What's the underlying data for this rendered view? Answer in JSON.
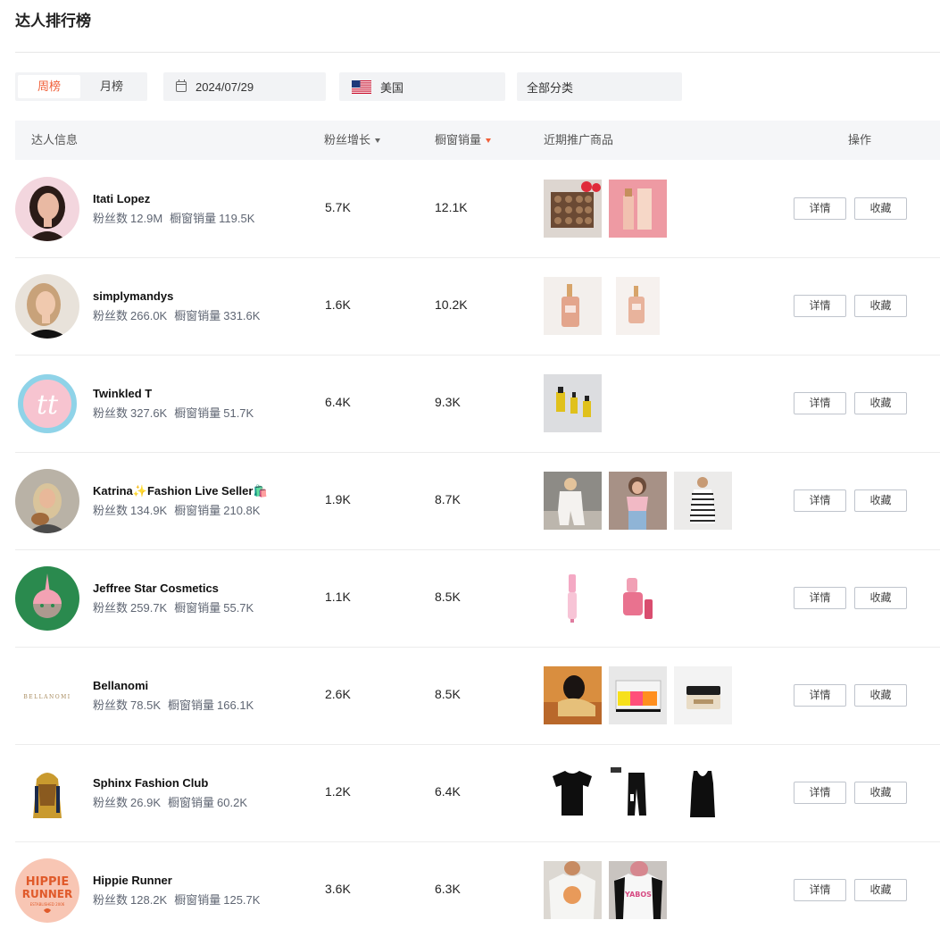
{
  "page": {
    "title": "达人排行榜"
  },
  "filters": {
    "tabs": [
      {
        "label": "周榜",
        "active": true
      },
      {
        "label": "月榜",
        "active": false
      }
    ],
    "date": "2024/07/29",
    "country": "美国",
    "category": "全部分类"
  },
  "table": {
    "headers": {
      "info": "达人信息",
      "fans_growth": "粉丝增长",
      "window_sales": "橱窗销量",
      "recent_products": "近期推广商品",
      "actions": "操作"
    },
    "sort_active": "window_sales",
    "labels": {
      "fans": "粉丝数",
      "sales": "橱窗销量",
      "detail": "详情",
      "favorite": "收藏"
    },
    "rows": [
      {
        "name": "Itati Lopez",
        "fans": "12.9M",
        "total_sales": "119.5K",
        "fans_growth": "5.7K",
        "window_sales": "12.1K",
        "products": [
          "chocolate-tray",
          "serum-box"
        ]
      },
      {
        "name": "simplymandys",
        "fans": "266.0K",
        "total_sales": "331.6K",
        "fans_growth": "1.6K",
        "window_sales": "10.2K",
        "products": [
          "dropper-bottle",
          "dropper-bottle-small"
        ]
      },
      {
        "name": "Twinkled T",
        "fans": "327.6K",
        "total_sales": "51.7K",
        "fans_growth": "6.4K",
        "window_sales": "9.3K",
        "products": [
          "oil-bottles"
        ]
      },
      {
        "name": "Katrina✨Fashion Live Seller🛍️",
        "fans": "134.9K",
        "total_sales": "210.8K",
        "fans_growth": "1.9K",
        "window_sales": "8.7K",
        "products": [
          "white-loungewear",
          "pink-top",
          "striped-dress"
        ]
      },
      {
        "name": "Jeffree Star Cosmetics",
        "fans": "259.7K",
        "total_sales": "55.7K",
        "fans_growth": "1.1K",
        "window_sales": "8.5K",
        "products": [
          "lip-gloss-tube",
          "pink-lip-bottle"
        ]
      },
      {
        "name": "Bellanomi",
        "fans": "78.5K",
        "total_sales": "166.1K",
        "fans_growth": "2.6K",
        "window_sales": "8.5K",
        "products": [
          "hooded-model",
          "neon-bag",
          "cream-jar"
        ]
      },
      {
        "name": "Sphinx Fashion Club",
        "fans": "26.9K",
        "total_sales": "60.2K",
        "fans_growth": "1.2K",
        "window_sales": "6.4K",
        "products": [
          "black-tshirt",
          "black-pants",
          "black-tank"
        ]
      },
      {
        "name": "Hippie Runner",
        "fans": "128.2K",
        "total_sales": "125.7K",
        "fans_growth": "3.6K",
        "window_sales": "6.3K",
        "products": [
          "graphic-tee-white",
          "graphic-raglan"
        ]
      }
    ]
  }
}
